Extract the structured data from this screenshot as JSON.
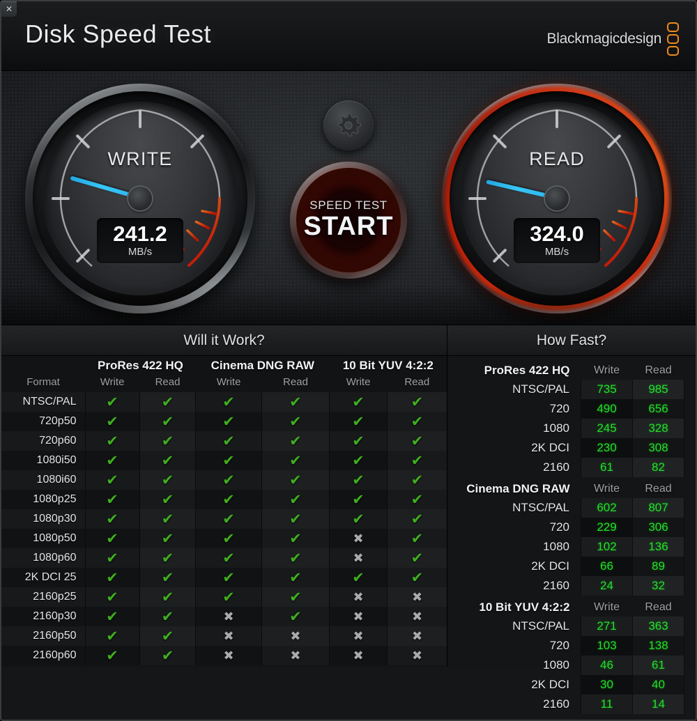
{
  "window": {
    "close_label": "✕"
  },
  "header": {
    "title": "Disk Speed Test",
    "brand": "Blackmagicdesign",
    "brand_color": "#ef8a1c"
  },
  "gauges": {
    "write": {
      "label": "WRITE",
      "value": "241.2",
      "unit": "MB/s",
      "needle_deg": 196,
      "hot": false
    },
    "read": {
      "label": "READ",
      "value": "324.0",
      "unit": "MB/s",
      "needle_deg": 193,
      "hot": true
    },
    "needle_color": "#36c6f7",
    "danger_color": "#cc1d05"
  },
  "center": {
    "gear_icon": "gear-icon",
    "start_sub": "SPEED TEST",
    "start_main": "START",
    "start_color": "#a82008"
  },
  "sections": {
    "left_title": "Will it Work?",
    "right_title": "How Fast?"
  },
  "will_it_work": {
    "format_header": "Format",
    "codec_groups": [
      "ProRes 422 HQ",
      "Cinema DNG RAW",
      "10 Bit YUV 4:2:2"
    ],
    "sub_headers": [
      "Write",
      "Read",
      "Write",
      "Read",
      "Write",
      "Read"
    ],
    "check_glyph": "✔",
    "cross_glyph": "✖",
    "check_color": "#3fae1f",
    "cross_color": "#a8abad",
    "rows": [
      {
        "format": "NTSC/PAL",
        "cells": [
          1,
          1,
          1,
          1,
          1,
          1
        ]
      },
      {
        "format": "720p50",
        "cells": [
          1,
          1,
          1,
          1,
          1,
          1
        ]
      },
      {
        "format": "720p60",
        "cells": [
          1,
          1,
          1,
          1,
          1,
          1
        ]
      },
      {
        "format": "1080i50",
        "cells": [
          1,
          1,
          1,
          1,
          1,
          1
        ]
      },
      {
        "format": "1080i60",
        "cells": [
          1,
          1,
          1,
          1,
          1,
          1
        ]
      },
      {
        "format": "1080p25",
        "cells": [
          1,
          1,
          1,
          1,
          1,
          1
        ]
      },
      {
        "format": "1080p30",
        "cells": [
          1,
          1,
          1,
          1,
          1,
          1
        ]
      },
      {
        "format": "1080p50",
        "cells": [
          1,
          1,
          1,
          1,
          0,
          1
        ]
      },
      {
        "format": "1080p60",
        "cells": [
          1,
          1,
          1,
          1,
          0,
          1
        ]
      },
      {
        "format": "2K DCI 25",
        "cells": [
          1,
          1,
          1,
          1,
          1,
          1
        ]
      },
      {
        "format": "2160p25",
        "cells": [
          1,
          1,
          1,
          1,
          0,
          0
        ]
      },
      {
        "format": "2160p30",
        "cells": [
          1,
          1,
          0,
          1,
          0,
          0
        ]
      },
      {
        "format": "2160p50",
        "cells": [
          1,
          1,
          0,
          0,
          0,
          0
        ]
      },
      {
        "format": "2160p60",
        "cells": [
          1,
          1,
          0,
          0,
          0,
          0
        ]
      }
    ]
  },
  "how_fast": {
    "write_header": "Write",
    "read_header": "Read",
    "value_color": "#22e028",
    "groups": [
      {
        "name": "ProRes 422 HQ",
        "rows": [
          {
            "res": "NTSC/PAL",
            "write": "735",
            "read": "985"
          },
          {
            "res": "720",
            "write": "490",
            "read": "656"
          },
          {
            "res": "1080",
            "write": "245",
            "read": "328"
          },
          {
            "res": "2K DCI",
            "write": "230",
            "read": "308"
          },
          {
            "res": "2160",
            "write": "61",
            "read": "82"
          }
        ]
      },
      {
        "name": "Cinema DNG RAW",
        "rows": [
          {
            "res": "NTSC/PAL",
            "write": "602",
            "read": "807"
          },
          {
            "res": "720",
            "write": "229",
            "read": "306"
          },
          {
            "res": "1080",
            "write": "102",
            "read": "136"
          },
          {
            "res": "2K DCI",
            "write": "66",
            "read": "89"
          },
          {
            "res": "2160",
            "write": "24",
            "read": "32"
          }
        ]
      },
      {
        "name": "10 Bit YUV 4:2:2",
        "rows": [
          {
            "res": "NTSC/PAL",
            "write": "271",
            "read": "363"
          },
          {
            "res": "720",
            "write": "103",
            "read": "138"
          },
          {
            "res": "1080",
            "write": "46",
            "read": "61"
          },
          {
            "res": "2K DCI",
            "write": "30",
            "read": "40"
          },
          {
            "res": "2160",
            "write": "11",
            "read": "14"
          }
        ]
      }
    ]
  }
}
